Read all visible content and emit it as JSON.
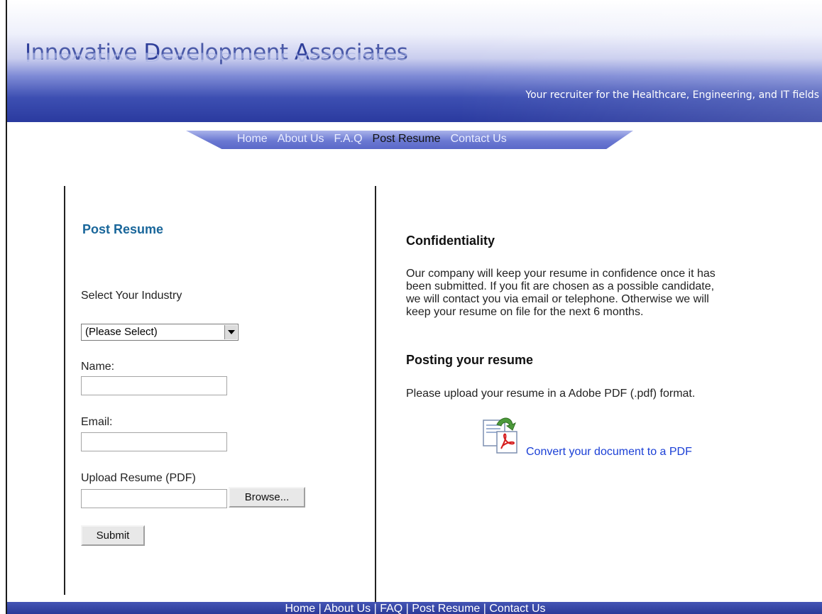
{
  "header": {
    "logo": {
      "parts": [
        {
          "cap": "I",
          "rest": "nnovative "
        },
        {
          "cap": "D",
          "rest": "evelopment "
        },
        {
          "cap": "A",
          "rest": "ssociates"
        }
      ]
    },
    "tagline": "Your recruiter for the Healthcare, Engineering, and IT fields"
  },
  "nav": {
    "items": [
      "Home",
      "About Us",
      "F.A.Q",
      "Post Resume",
      "Contact Us"
    ],
    "active": "Post Resume"
  },
  "form": {
    "title": "Post Resume",
    "industry_label": "Select Your Industry",
    "industry_value": "(Please Select)",
    "name_label": "Name:",
    "name_value": "",
    "email_label": "Email:",
    "email_value": "",
    "upload_label": "Upload Resume (PDF)",
    "browse_label": "Browse...",
    "submit_label": "Submit"
  },
  "info": {
    "confidentiality_title": "Confidentiality",
    "confidentiality_lines": [
      "Our company will keep your resume in confidence once it has",
      "been submitted. If you fit are chosen as a possible candidate,",
      "we will contact you via email or telephone. Otherwise we will",
      "keep your resume on file for the next 6 months."
    ],
    "posting_title": "Posting your resume",
    "posting_text": "Please upload your resume in a Adobe PDF (.pdf) format.",
    "pdf_link": "Convert your document to a PDF"
  },
  "footer": {
    "links": [
      "Home",
      "About Us",
      "FAQ",
      "Post Resume",
      "Contact Us"
    ],
    "separator": " | "
  },
  "colors": {
    "title_blue": "#19669a",
    "link_blue": "#1a3fd6",
    "banner_dark": "#2a3a9f"
  }
}
